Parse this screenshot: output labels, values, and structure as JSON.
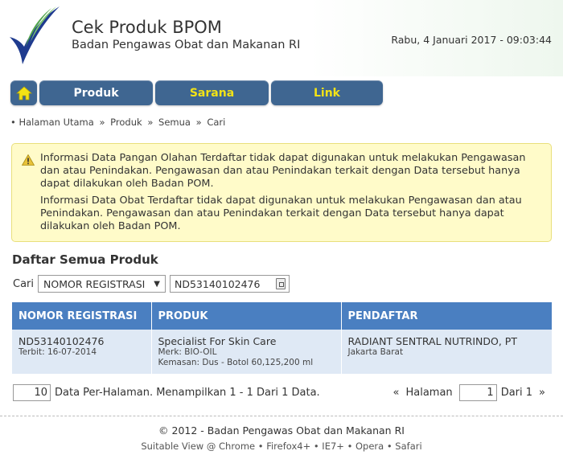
{
  "header": {
    "title": "Cek Produk BPOM",
    "subtitle": "Badan Pengawas Obat dan Makanan RI",
    "datetime": "Rabu, 4 Januari 2017 - 09:03:44"
  },
  "nav": {
    "home_icon": "home-icon",
    "items": [
      {
        "label": "Produk",
        "color": "#ffffff"
      },
      {
        "label": "Sarana",
        "color": "#f3e316"
      },
      {
        "label": "Link",
        "color": "#f3e316"
      }
    ]
  },
  "breadcrumb": {
    "bullet": "•",
    "separator": "»",
    "items": [
      "Halaman Utama",
      "Produk",
      "Semua",
      "Cari"
    ]
  },
  "alert": {
    "icon": "warning-icon",
    "paragraphs": [
      "Informasi Data Pangan Olahan Terdaftar tidak dapat digunakan untuk melakukan Pengawasan dan atau Penindakan. Pengawasan dan atau Penindakan terkait dengan Data tersebut hanya dapat dilakukan oleh Badan POM.",
      "Informasi Data Obat Terdaftar tidak dapat digunakan untuk melakukan Pengawasan dan atau Penindakan. Pengawasan dan atau Penindakan terkait dengan Data tersebut hanya dapat dilakukan oleh Badan POM."
    ]
  },
  "section_title": "Daftar Semua Produk",
  "search": {
    "label": "Cari",
    "select_value": "NOMOR REGISTRASI",
    "input_value": "ND53140102476"
  },
  "table": {
    "headers": [
      "NOMOR REGISTRASI",
      "PRODUK",
      "PENDAFTAR"
    ],
    "rows": [
      {
        "nomor": "ND53140102476",
        "terbit": "Terbit: 16-07-2014",
        "produk": "Specialist For Skin Care",
        "merk": "Merk: BIO-OIL",
        "kemasan": "Kemasan: Dus - Botol 60,125,200 ml",
        "pendaftar": "RADIANT SENTRAL NUTRINDO, PT",
        "kota": "Jakarta Barat"
      }
    ]
  },
  "pager": {
    "per_page": "10",
    "per_page_text": "Data Per-Halaman. Menampilkan 1 - 1 Dari 1 Data.",
    "prev": "«",
    "halaman_label": "Halaman",
    "page": "1",
    "of_text": "Dari 1",
    "next": "»"
  },
  "footer": {
    "copyright": "© 2012 - Badan Pengawas Obat dan Makanan RI",
    "compat": "Suitable View @ Chrome • Firefox4+ • IE7+ • Opera • Safari"
  },
  "colors": {
    "nav_bg": "#3f6691",
    "table_header": "#4a7fc1",
    "table_row": "#dfe9f5",
    "alert_bg": "#fffbc9"
  }
}
